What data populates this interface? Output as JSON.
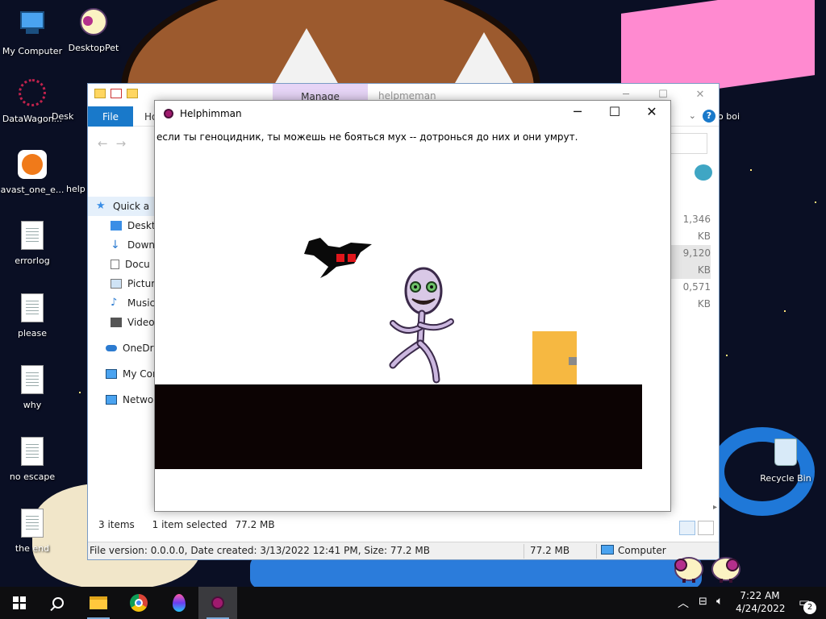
{
  "desktop": {
    "icons_left": [
      {
        "label": "My Computer",
        "icon": "my-computer-icon"
      },
      {
        "label": "DataWagon...",
        "icon": "datawagon-icon"
      },
      {
        "label": "avast_one_e...",
        "icon": "avast-icon"
      },
      {
        "label": "errorlog",
        "icon": "text-file-icon"
      },
      {
        "label": "please",
        "icon": "text-file-icon"
      },
      {
        "label": "why",
        "icon": "text-file-icon"
      },
      {
        "label": "no escape",
        "icon": "text-file-icon"
      },
      {
        "label": "the end",
        "icon": "text-file-icon"
      }
    ],
    "desktoppet": {
      "label": "DesktopPet",
      "icon": "sheep-icon"
    },
    "desk_partial": "Desk",
    "help_partial": "help",
    "recycle_bin": {
      "label": "Recycle Bin",
      "icon": "recycle-bin-icon"
    },
    "partial_right_label": "o boi"
  },
  "explorer": {
    "manage_tab": "Manage",
    "title": "helpmeman",
    "file_tab": "File",
    "home_tab": "Ho",
    "help_symbol": "?",
    "sidebar": [
      {
        "label": "Quick a",
        "icon": "star-icon",
        "selected": true
      },
      {
        "label": "Deskt",
        "icon": "desktop-icon"
      },
      {
        "label": "Down",
        "icon": "download-icon"
      },
      {
        "label": "Docu",
        "icon": "document-icon"
      },
      {
        "label": "Pictur",
        "icon": "pictures-icon"
      },
      {
        "label": "Music",
        "icon": "music-icon"
      },
      {
        "label": "Video",
        "icon": "video-icon"
      },
      {
        "label": "OneDriv",
        "icon": "onedrive-icon"
      },
      {
        "label": "My Cor",
        "icon": "computer-icon"
      },
      {
        "label": "Networ",
        "icon": "network-icon"
      }
    ],
    "file_sizes": [
      "1,346 KB",
      "9,120 KB",
      "0,571 KB"
    ],
    "item_count": "3 items",
    "selection": "1 item selected",
    "selection_size": "77.2 MB",
    "details": "File version: 0.0.0.0, Date created: 3/13/2022 12:41 PM, Size: 77.2 MB",
    "details_size": "77.2 MB",
    "location": "Computer"
  },
  "game": {
    "title": "Helphimman",
    "message": "если ты геноцидник,  ты можешь не бояться мух -- дотронься до них и они умрут.",
    "colors": {
      "floor": "#0c0303",
      "box": "#f6b841",
      "fly_eyes": "#e0161b"
    }
  },
  "taskbar": {
    "time": "7:22 AM",
    "date": "4/24/2022",
    "notification_count": "2",
    "apps": [
      "start-button",
      "search-icon",
      "file-explorer-icon",
      "chrome-icon",
      "maps-icon",
      "helphimman-icon"
    ]
  },
  "window_controls": {
    "minimize": "─",
    "maximize": "☐",
    "close": "✕"
  }
}
